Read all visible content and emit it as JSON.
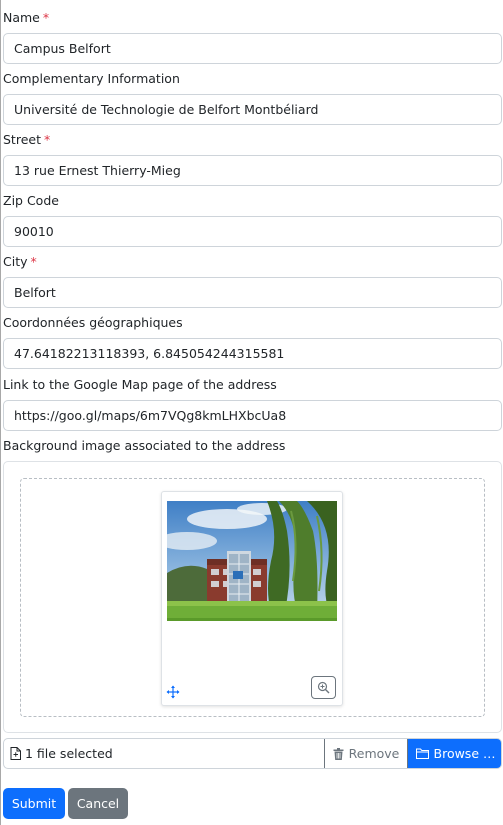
{
  "form": {
    "fields": [
      {
        "label": "Name",
        "required": true,
        "value": "Campus Belfort"
      },
      {
        "label": "Complementary Information",
        "required": false,
        "value": "Université de Technologie de Belfort Montbéliard"
      },
      {
        "label": "Street",
        "required": true,
        "value": "13 rue Ernest Thierry-Mieg"
      },
      {
        "label": "Zip Code",
        "required": false,
        "value": "90010"
      },
      {
        "label": "City",
        "required": true,
        "value": "Belfort"
      },
      {
        "label": "Coordonnées géographiques",
        "required": false,
        "value": "47.64182213118393, 6.845054244315581"
      },
      {
        "label": "Link to the Google Map page of the address",
        "required": false,
        "value": "https://goo.gl/maps/6m7VQg8kmLHXbcUa8"
      }
    ],
    "required_marker": "*",
    "background_image": {
      "label": "Background image associated to the address",
      "file_caption": "1 file selected",
      "remove_label": "Remove",
      "browse_label": "Browse …"
    },
    "submit_label": "Submit",
    "cancel_label": "Cancel"
  },
  "colors": {
    "primary": "#0d6efd",
    "secondary": "#6c757d",
    "required": "#dc3545",
    "border": "#ced4da"
  },
  "icons": [
    "file-icon",
    "trash-icon",
    "folder-icon",
    "move-icon",
    "zoom-in-icon"
  ]
}
